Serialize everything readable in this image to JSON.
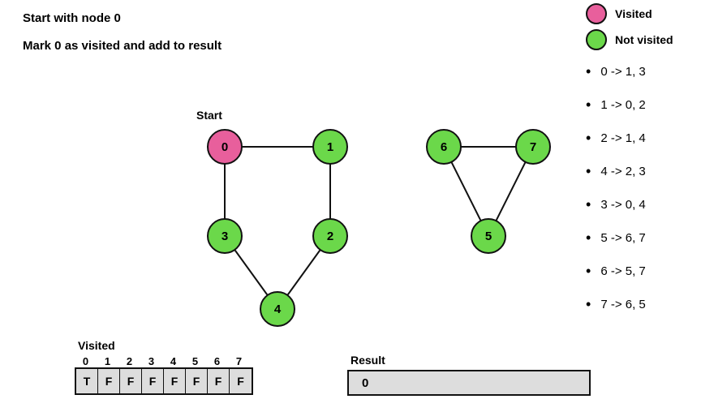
{
  "title1": "Start with node 0",
  "title2": "Mark 0 as visited and add to result",
  "start_label": "Start",
  "legend": {
    "visited": "Visited",
    "not_visited": "Not visited",
    "visited_color": "#e85f9c",
    "not_visited_color": "#6bd84a"
  },
  "nodes": {
    "n0": "0",
    "n1": "1",
    "n2": "2",
    "n3": "3",
    "n4": "4",
    "n5": "5",
    "n6": "6",
    "n7": "7"
  },
  "adjacency": [
    "0 -> 1, 3",
    "1 -> 0, 2",
    "2 -> 1, 4",
    "4 -> 2, 3",
    "3 -> 0, 4",
    "5 -> 6, 7",
    "6 -> 5, 7",
    "7 -> 6, 5"
  ],
  "visited_label": "Visited",
  "visited_indices": [
    "0",
    "1",
    "2",
    "3",
    "4",
    "5",
    "6",
    "7"
  ],
  "visited_values": [
    "T",
    "F",
    "F",
    "F",
    "F",
    "F",
    "F",
    "F"
  ],
  "result_label": "Result",
  "result_value": "0",
  "chart_data": {
    "type": "graph",
    "title": "BFS/DFS traversal step — start at node 0, mark visited",
    "nodes": [
      {
        "id": 0,
        "visited": true
      },
      {
        "id": 1,
        "visited": false
      },
      {
        "id": 2,
        "visited": false
      },
      {
        "id": 3,
        "visited": false
      },
      {
        "id": 4,
        "visited": false
      },
      {
        "id": 5,
        "visited": false
      },
      {
        "id": 6,
        "visited": false
      },
      {
        "id": 7,
        "visited": false
      }
    ],
    "edges": [
      [
        0,
        1
      ],
      [
        0,
        3
      ],
      [
        1,
        2
      ],
      [
        2,
        4
      ],
      [
        3,
        4
      ],
      [
        5,
        6
      ],
      [
        5,
        7
      ],
      [
        6,
        7
      ]
    ],
    "start_node": 0,
    "visited_array": [
      true,
      false,
      false,
      false,
      false,
      false,
      false,
      false
    ],
    "result": [
      0
    ],
    "adjacency_list": {
      "0": [
        1,
        3
      ],
      "1": [
        0,
        2
      ],
      "2": [
        1,
        4
      ],
      "4": [
        2,
        3
      ],
      "3": [
        0,
        4
      ],
      "5": [
        6,
        7
      ],
      "6": [
        5,
        7
      ],
      "7": [
        6,
        5
      ]
    }
  }
}
